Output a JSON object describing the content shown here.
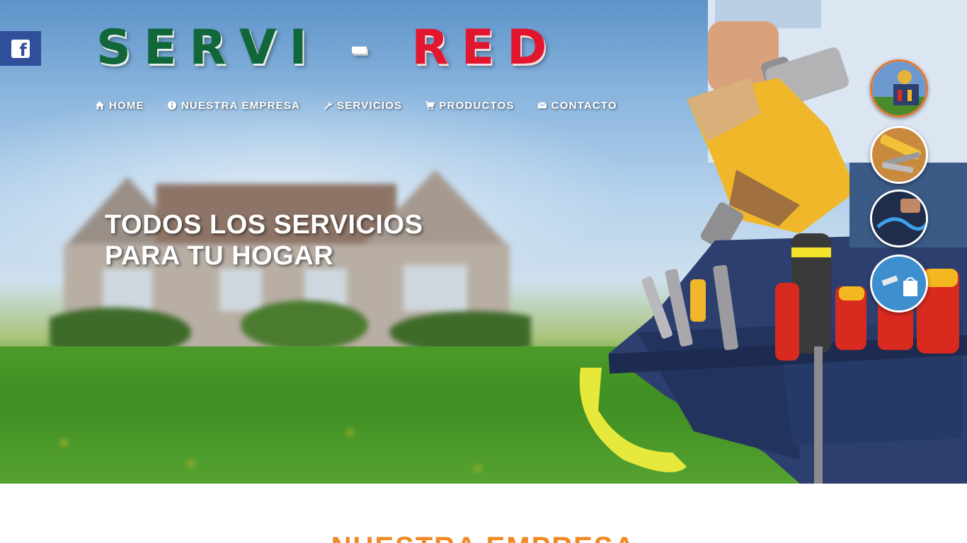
{
  "brand": {
    "logo_part1": "SERVI",
    "logo_dash": "-",
    "logo_part2": "RED",
    "color_green": "#11663a",
    "color_red": "#e2162f"
  },
  "social": {
    "facebook_icon": "facebook-icon",
    "facebook_letter": "f",
    "facebook_color": "#2f4f9b"
  },
  "nav": {
    "items": [
      {
        "label": "HOME",
        "icon": "home-icon"
      },
      {
        "label": "NUESTRA EMPRESA",
        "icon": "info-icon"
      },
      {
        "label": "SERVICIOS",
        "icon": "wrench-icon"
      },
      {
        "label": "PRODUCTOS",
        "icon": "cart-icon"
      },
      {
        "label": "CONTACTO",
        "icon": "envelope-icon"
      }
    ]
  },
  "hero": {
    "headline_line1": "TODOS LOS SERVICIOS",
    "headline_line2": "PARA TU HOGAR"
  },
  "slider": {
    "active_index": 0,
    "active_border_color": "#e9762b",
    "thumbnails": [
      "worker-tools-thumbnail",
      "tool-belt-thumbnail",
      "electronics-thumbnail",
      "shopping-thumbnail"
    ]
  },
  "section": {
    "title": "NUESTRA EMPRESA",
    "title_color": "#f08a24"
  }
}
